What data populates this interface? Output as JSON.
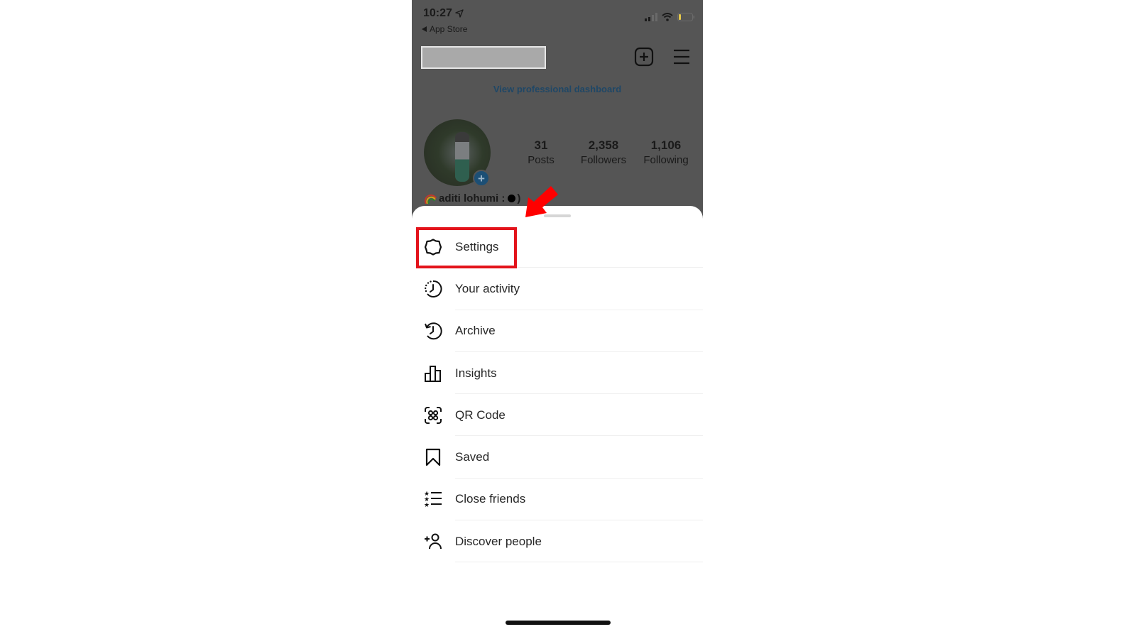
{
  "status_bar": {
    "time": "10:27",
    "location_icon": "location-arrow-icon",
    "back_label": "App Store",
    "signal_icon": "cellular-signal-icon",
    "wifi_icon": "wifi-icon",
    "battery_icon": "battery-low-icon",
    "battery_color": "#e6c84a"
  },
  "header": {
    "username_redacted": "",
    "new_post_icon": "plus-square-icon",
    "menu_icon": "hamburger-menu-icon",
    "pro_dashboard_link": "View professional dashboard"
  },
  "profile": {
    "display_name": "aditi lohumi :",
    "name_suffix": ")",
    "name_emoji": "rainbow",
    "stats": [
      {
        "value": "31",
        "label": "Posts"
      },
      {
        "value": "2,358",
        "label": "Followers"
      },
      {
        "value": "1,106",
        "label": "Following"
      }
    ],
    "add_story_icon": "plus-circle-icon"
  },
  "sheet": {
    "items": [
      {
        "label": "Settings",
        "icon": "settings-gear-icon",
        "highlighted": true
      },
      {
        "label": "Your activity",
        "icon": "activity-clock-icon"
      },
      {
        "label": "Archive",
        "icon": "archive-history-icon"
      },
      {
        "label": "Insights",
        "icon": "bar-chart-icon"
      },
      {
        "label": "QR Code",
        "icon": "qr-code-icon"
      },
      {
        "label": "Saved",
        "icon": "bookmark-icon"
      },
      {
        "label": "Close friends",
        "icon": "star-list-icon"
      },
      {
        "label": "Discover people",
        "icon": "add-person-icon"
      }
    ]
  },
  "annotation": {
    "highlight_color": "#e3131b",
    "arrow_color": "#ff0000"
  },
  "colors": {
    "dim_background": "#555555",
    "link": "#1f4766",
    "text": "#262626"
  }
}
